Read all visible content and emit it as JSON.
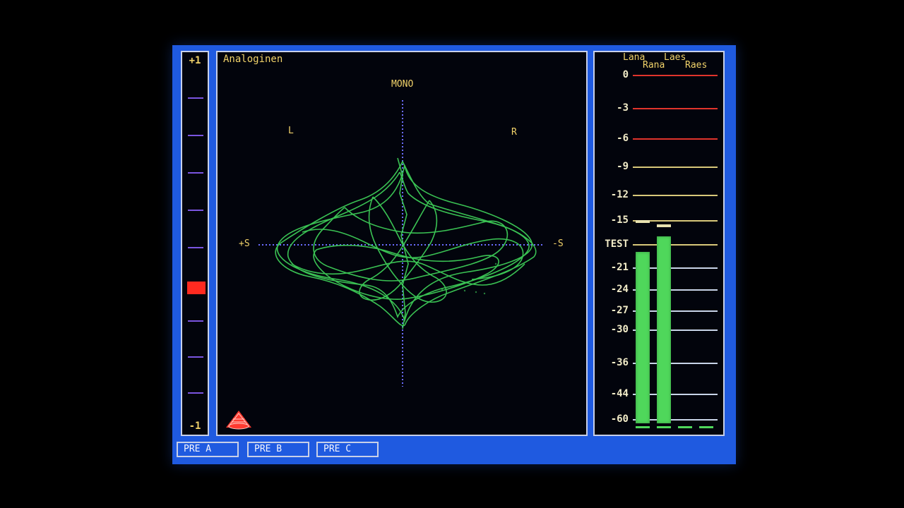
{
  "correlation": {
    "top_label": "+1",
    "bottom_label": "-1",
    "value": -0.25
  },
  "goniometer": {
    "title": "Analoginen",
    "labels": {
      "mono": "MONO",
      "left": "L",
      "right": "R",
      "plus_s": "+S",
      "minus_s": "-S"
    }
  },
  "meter": {
    "channels": [
      "Lana",
      "Rana",
      "Laes",
      "Raes"
    ],
    "scale": [
      {
        "label": "0",
        "color": "#e0342c"
      },
      {
        "label": "-3",
        "color": "#e0342c"
      },
      {
        "label": "-6",
        "color": "#e0342c"
      },
      {
        "label": "-9",
        "color": "#d8c87a"
      },
      {
        "label": "-12",
        "color": "#d8c87a"
      },
      {
        "label": "-15",
        "color": "#d8c87a"
      },
      {
        "label": "TEST",
        "color": "#d8c87a"
      },
      {
        "label": "-21",
        "color": "#c8d4e8"
      },
      {
        "label": "-24",
        "color": "#c8d4e8"
      },
      {
        "label": "-27",
        "color": "#c8d4e8"
      },
      {
        "label": "-30",
        "color": "#c8d4e8"
      },
      {
        "label": "-36",
        "color": "#c8d4e8"
      },
      {
        "label": "-44",
        "color": "#c8d4e8"
      },
      {
        "label": "-60",
        "color": "#c8d4e8"
      }
    ],
    "levels_db": {
      "Lana": -19,
      "Rana": -17,
      "Laes": -60,
      "Raes": -60
    },
    "peaks_db": {
      "Lana": -15,
      "Rana": -15.5
    }
  },
  "presets": [
    "PRE A",
    "PRE B",
    "PRE C"
  ]
}
